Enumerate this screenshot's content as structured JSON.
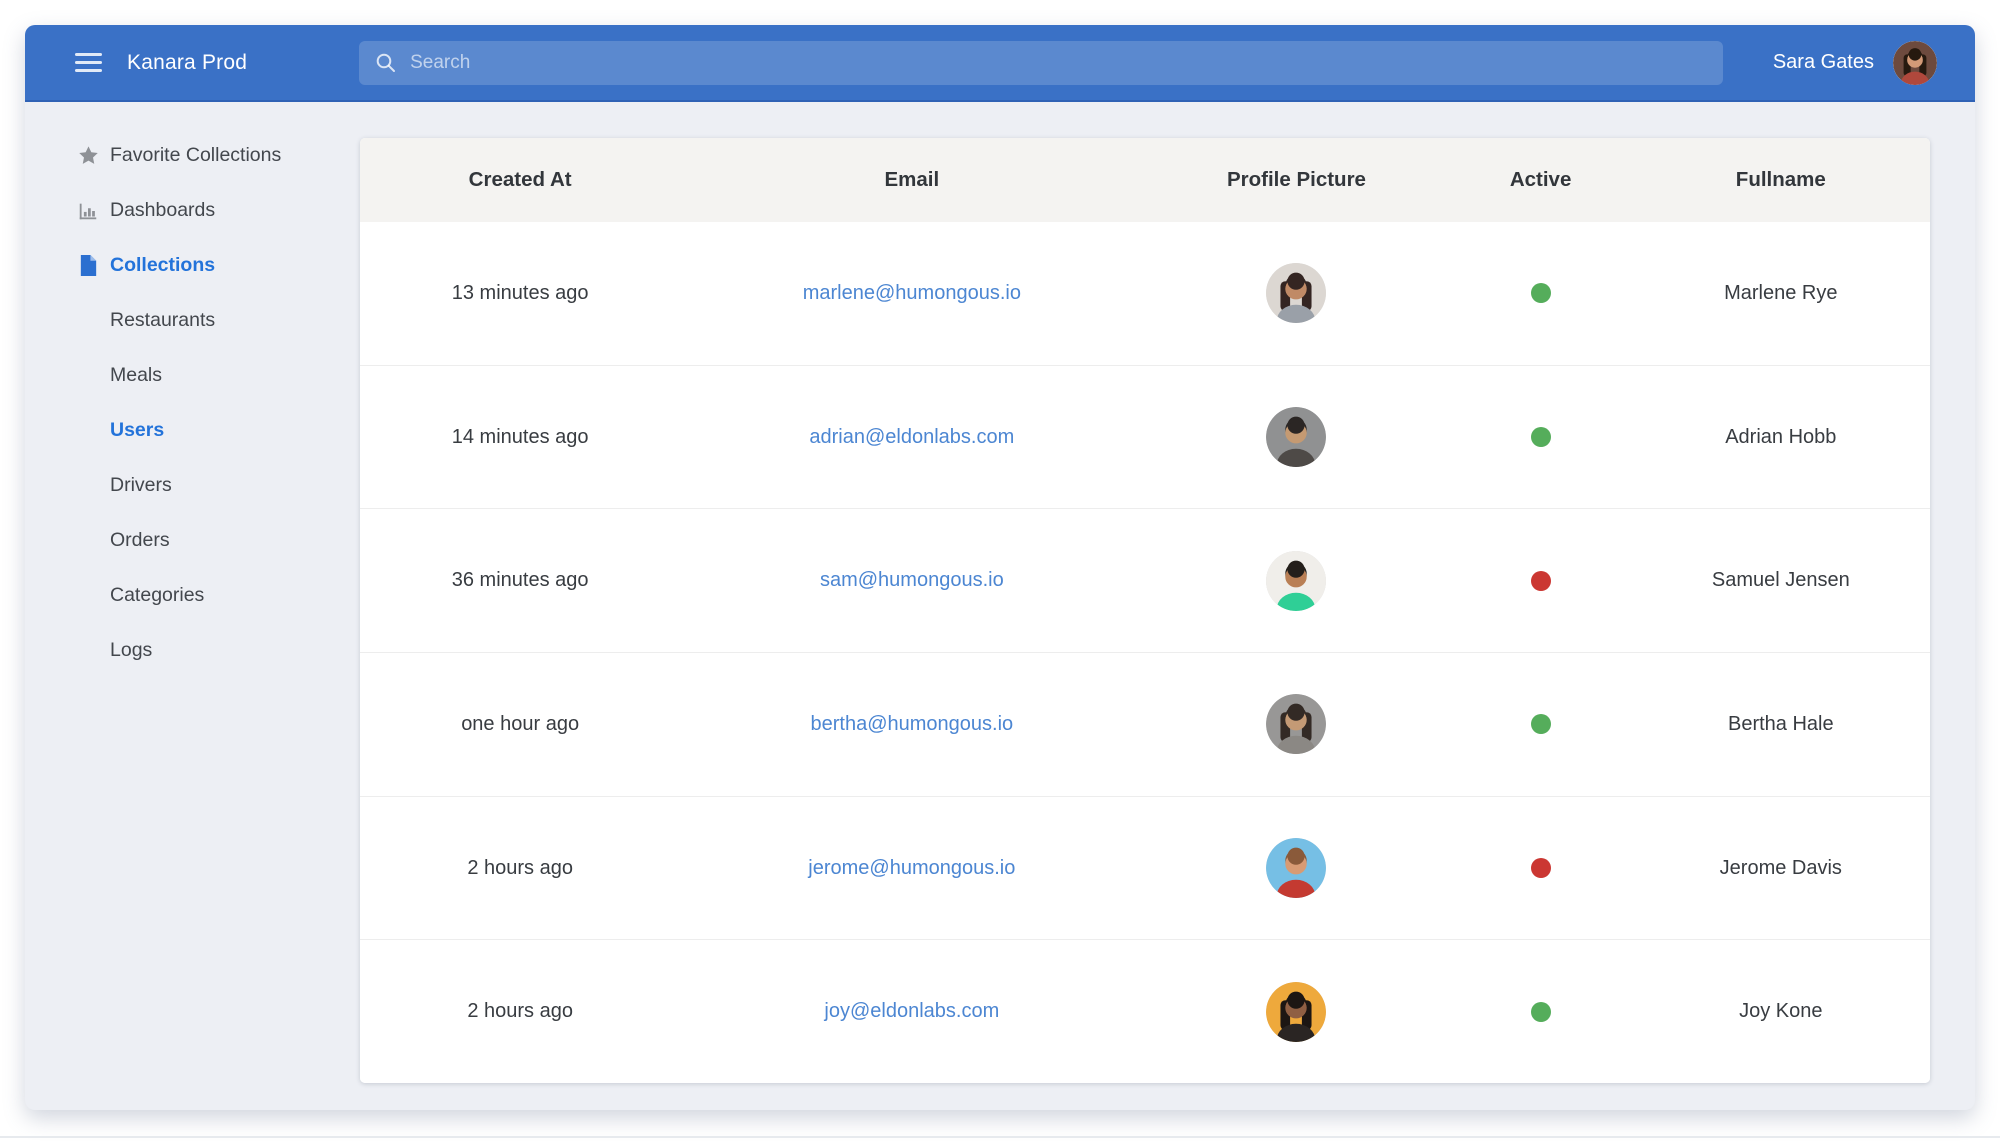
{
  "topbar": {
    "app_title": "Kanara Prod",
    "search_placeholder": "Search",
    "user_name": "Sara Gates",
    "user_avatar": {
      "bg": "#6d4a3e",
      "skin": "#d39a77",
      "hair": "#26190f",
      "shirt": "#b0483c",
      "long_hair": true
    }
  },
  "sidebar": {
    "items": [
      {
        "label": "Favorite Collections",
        "icon": "star",
        "active": false,
        "sub": false
      },
      {
        "label": "Dashboards",
        "icon": "bar-chart",
        "active": false,
        "sub": false
      },
      {
        "label": "Collections",
        "icon": "document",
        "active": true,
        "sub": false
      },
      {
        "label": "Restaurants",
        "icon": null,
        "active": false,
        "sub": true
      },
      {
        "label": "Meals",
        "icon": null,
        "active": false,
        "sub": true
      },
      {
        "label": "Users",
        "icon": null,
        "active": true,
        "sub": true
      },
      {
        "label": "Drivers",
        "icon": null,
        "active": false,
        "sub": true
      },
      {
        "label": "Orders",
        "icon": null,
        "active": false,
        "sub": true
      },
      {
        "label": "Categories",
        "icon": null,
        "active": false,
        "sub": true
      },
      {
        "label": "Logs",
        "icon": null,
        "active": false,
        "sub": true
      }
    ]
  },
  "table": {
    "columns": [
      "Created At",
      "Email",
      "Profile Picture",
      "Active",
      "Fullname"
    ],
    "rows": [
      {
        "created_at": "13 minutes ago",
        "email": "marlene@humongous.io",
        "active": true,
        "fullname": "Marlene Rye",
        "avatar": {
          "bg": "#dcd7d2",
          "skin": "#c08a66",
          "hair": "#342522",
          "shirt": "#9aa0a8",
          "long_hair": true
        }
      },
      {
        "created_at": "14 minutes ago",
        "email": "adrian@eldonlabs.com",
        "active": true,
        "fullname": "Adrian Hobb",
        "avatar": {
          "bg": "#909192",
          "skin": "#c59a72",
          "hair": "#2b2624",
          "shirt": "#4e4a47",
          "long_hair": false
        }
      },
      {
        "created_at": "36 minutes ago",
        "email": "sam@humongous.io",
        "active": false,
        "fullname": "Samuel Jensen",
        "avatar": {
          "bg": "#f0eeea",
          "skin": "#b97f55",
          "hair": "#241f1b",
          "shirt": "#2fcf96",
          "long_hair": false
        }
      },
      {
        "created_at": "one hour ago",
        "email": "bertha@humongous.io",
        "active": true,
        "fullname": "Bertha Hale",
        "avatar": {
          "bg": "#989796",
          "skin": "#c49a75",
          "hair": "#332a25",
          "shirt": "#8b8884",
          "long_hair": true
        }
      },
      {
        "created_at": "2 hours ago",
        "email": "jerome@humongous.io",
        "active": false,
        "fullname": "Jerome Davis",
        "avatar": {
          "bg": "#76bfe5",
          "skin": "#d89b74",
          "hair": "#8a5a3a",
          "shirt": "#c43a31",
          "long_hair": false
        }
      },
      {
        "created_at": "2 hours ago",
        "email": "joy@eldonlabs.com",
        "active": true,
        "fullname": "Joy Kone",
        "avatar": {
          "bg": "#eea93c",
          "skin": "#8f5f43",
          "hair": "#1c1613",
          "shirt": "#2a2523",
          "long_hair": true
        }
      }
    ]
  },
  "colors": {
    "topbar_blue": "#3a71c6",
    "sidebar_active_blue": "#2373da",
    "link_blue": "#4c86d2",
    "status_active_green": "#55ad5b",
    "status_inactive_red": "#cb3732"
  }
}
